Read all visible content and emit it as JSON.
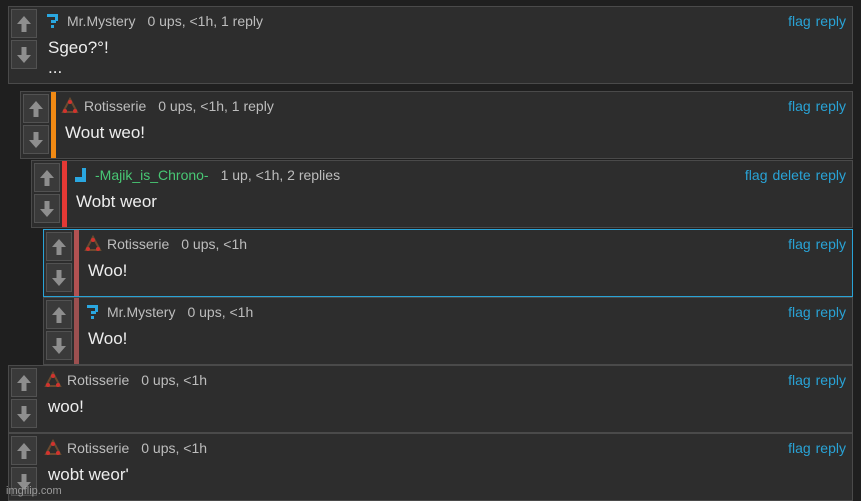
{
  "vote_labels": {
    "up": "upvote",
    "down": "downvote"
  },
  "comments": [
    {
      "user": "Mr.Mystery",
      "avatar": "question-mark-icon",
      "meta": "0 ups, <1h, 1 reply",
      "text": "Sgeo?°!",
      "text2": "...",
      "actions": [
        "flag",
        "reply"
      ]
    },
    {
      "user": "Rotisserie",
      "avatar": "triangle-dots-icon",
      "meta": "0 ups, <1h, 1 reply",
      "text": "Wout weo!",
      "actions": [
        "flag",
        "reply"
      ],
      "bar_color": "#f18a14"
    },
    {
      "user": "-Majik_is_Chrono-",
      "avatar": "blue-block-icon",
      "meta": "1 up, <1h, 2 replies",
      "text": "Wobt weor",
      "actions": [
        "flag",
        "delete",
        "reply"
      ],
      "bar_color": "#e53935",
      "user_color": "#48c774"
    },
    {
      "user": "Rotisserie",
      "avatar": "triangle-dots-icon",
      "meta": "0 ups, <1h",
      "text": "Woo!",
      "actions": [
        "flag",
        "reply"
      ],
      "bar_color": "#b25252"
    },
    {
      "user": "Mr.Mystery",
      "avatar": "question-mark-icon",
      "meta": "0 ups, <1h",
      "text": "Woo!",
      "actions": [
        "flag",
        "reply"
      ],
      "bar_color": "#9c5050"
    },
    {
      "user": "Rotisserie",
      "avatar": "triangle-dots-icon",
      "meta": "0 ups, <1h",
      "text": "woo!",
      "actions": [
        "flag",
        "reply"
      ]
    },
    {
      "user": "Rotisserie",
      "avatar": "triangle-dots-icon",
      "meta": "0 ups, <1h",
      "text": "wobt weor'",
      "actions": [
        "flag",
        "reply"
      ]
    }
  ],
  "watermark": "imgflip.com",
  "colors": {
    "link": "#29a3d6",
    "highlight_border": "#29a3d6"
  }
}
